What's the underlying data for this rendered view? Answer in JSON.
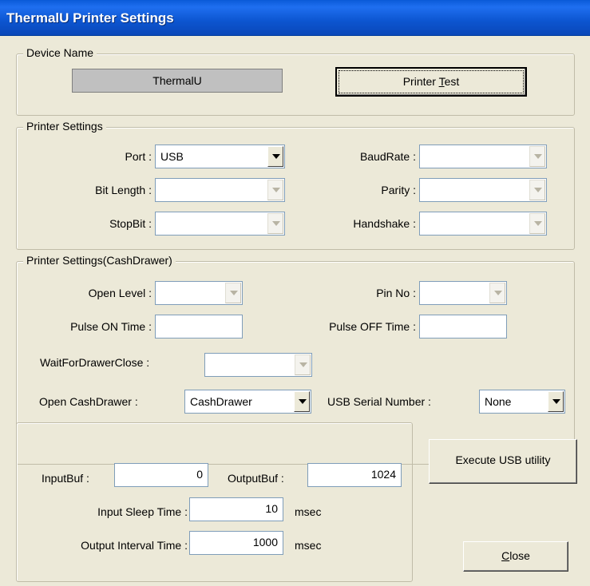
{
  "window": {
    "title": "ThermalU Printer Settings"
  },
  "device": {
    "group_label": "Device Name",
    "name_value": "ThermalU",
    "test_button": "Printer Test"
  },
  "printer_settings": {
    "group_label": "Printer Settings",
    "port_label": "Port :",
    "port_value": "USB",
    "baudrate_label": "BaudRate :",
    "baudrate_value": "",
    "bitlength_label": "Bit Length :",
    "bitlength_value": "",
    "parity_label": "Parity :",
    "parity_value": "",
    "stopbit_label": "StopBit :",
    "stopbit_value": "",
    "handshake_label": "Handshake :",
    "handshake_value": ""
  },
  "cashdrawer": {
    "group_label": "Printer Settings(CashDrawer)",
    "open_level_label": "Open Level :",
    "open_level_value": "",
    "pin_no_label": "Pin No :",
    "pin_no_value": "",
    "pulse_on_label": "Pulse ON Time :",
    "pulse_on_value": "",
    "pulse_off_label": "Pulse OFF Time :",
    "pulse_off_value": "",
    "wait_close_label": "WaitForDrawerClose :",
    "wait_close_value": "",
    "open_drawer_label": "Open CashDrawer :",
    "open_drawer_value": "CashDrawer",
    "usb_serial_label": "USB Serial Number :",
    "usb_serial_value": "None"
  },
  "buffers": {
    "inputbuf_label": "InputBuf :",
    "inputbuf_value": "0",
    "outputbuf_label": "OutputBuf :",
    "outputbuf_value": "1024",
    "input_sleep_label": "Input Sleep Time :",
    "input_sleep_value": "10",
    "input_sleep_unit": "msec",
    "output_interval_label": "Output Interval Time :",
    "output_interval_value": "1000",
    "output_interval_unit": "msec"
  },
  "actions": {
    "execute_usb": "Execute USB utility",
    "close": "Close"
  }
}
